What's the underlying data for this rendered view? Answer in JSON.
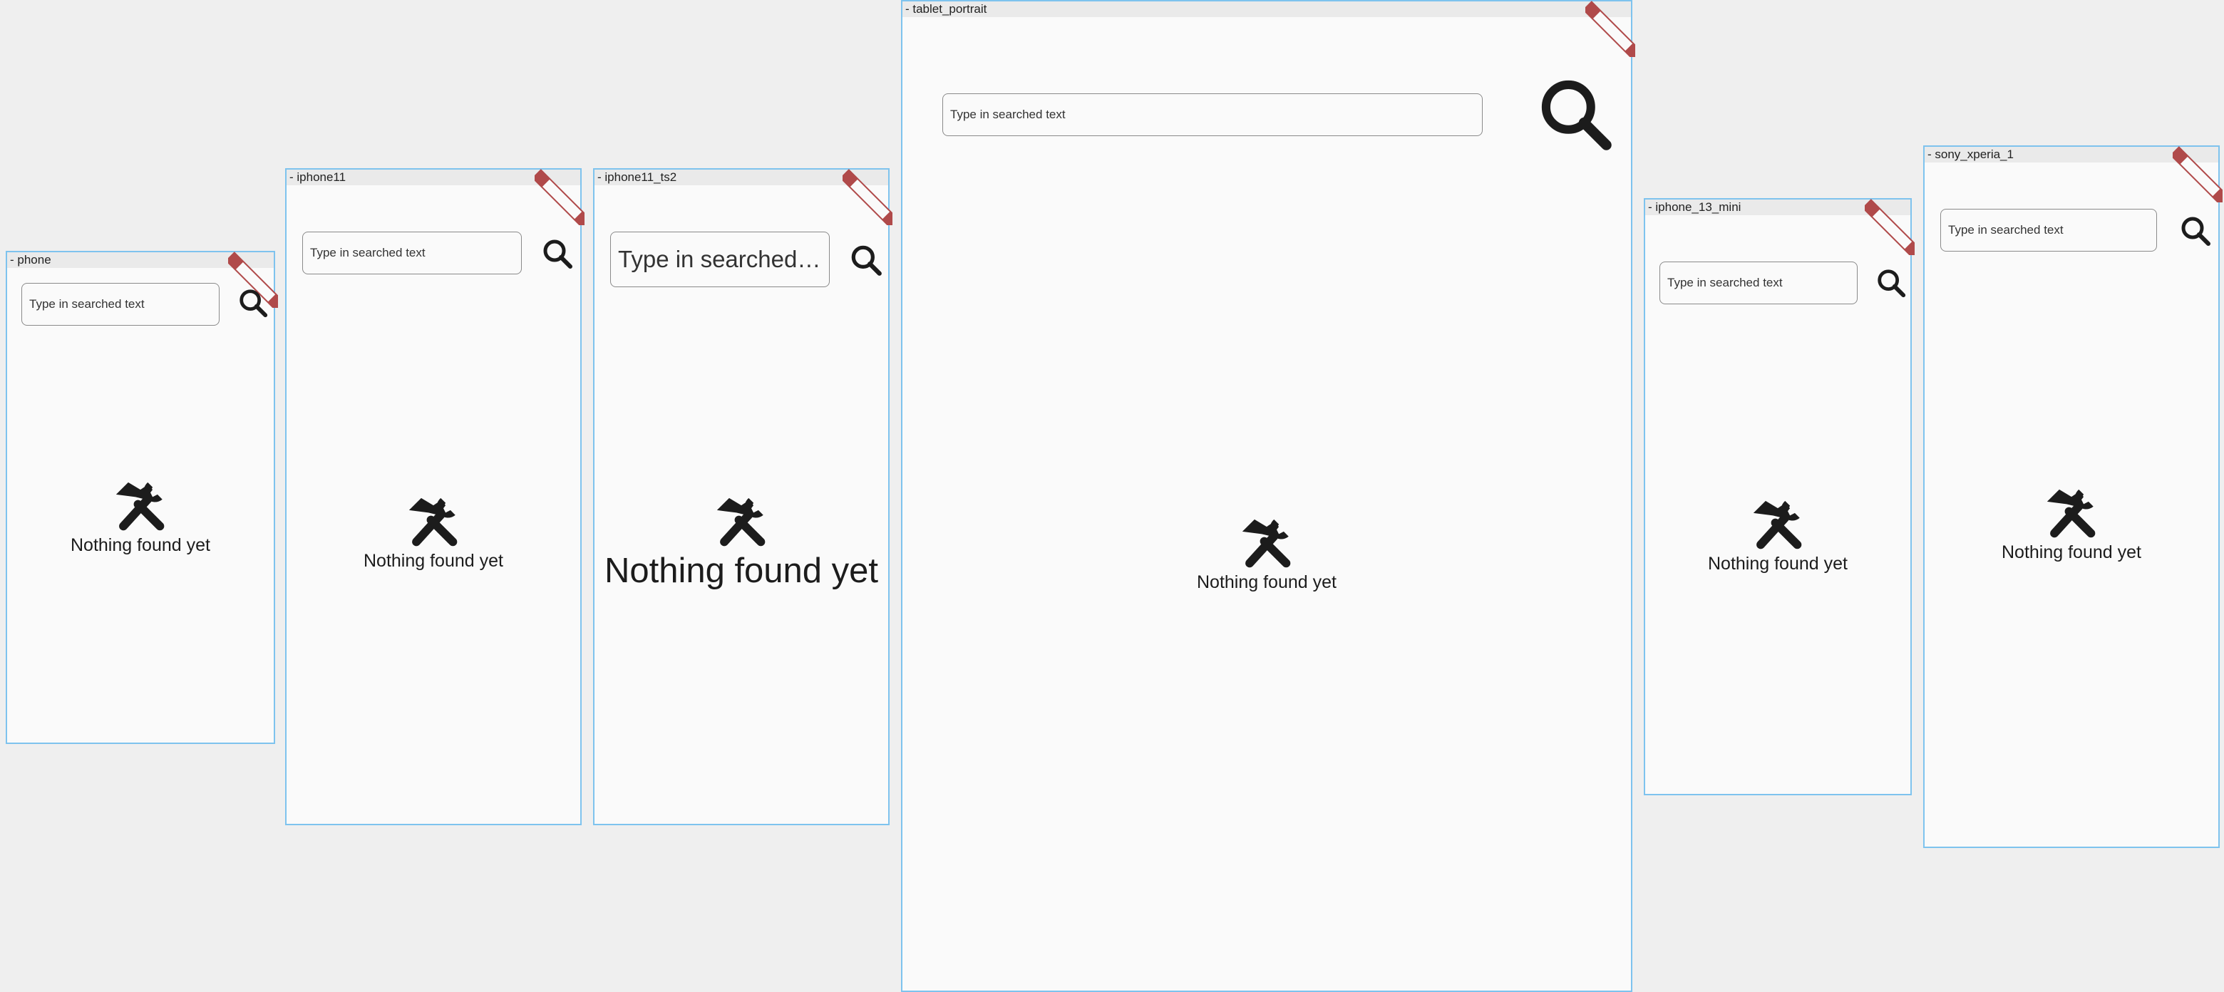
{
  "devices": {
    "phone": {
      "label": "- phone",
      "search_placeholder": "Type in searched text",
      "empty_text": "Nothing found yet"
    },
    "iphone11": {
      "label": "- iphone11",
      "search_placeholder": "Type in searched text",
      "empty_text": "Nothing found yet"
    },
    "iphone11_ts2": {
      "label": "- iphone11_ts2",
      "search_placeholder": "Type in searched text",
      "empty_text": "Nothing found yet"
    },
    "tablet_portrait": {
      "label": "- tablet_portrait",
      "search_placeholder": "Type in searched text",
      "empty_text": "Nothing found yet"
    },
    "iphone_13_mini": {
      "label": "- iphone_13_mini",
      "search_placeholder": "Type in searched text",
      "empty_text": "Nothing found yet"
    },
    "sony_xperia_1": {
      "label": "- sony_xperia_1",
      "search_placeholder": "Type in searched text",
      "empty_text": "Nothing found yet"
    }
  },
  "colors": {
    "canvas_background": "#efefef",
    "device_border": "#7ec3ee",
    "screen_background": "#fafafa",
    "debug_banner": "#b04a4a",
    "icon": "#1c1c1c"
  },
  "icons": {
    "search": "search-icon",
    "empty_state": "tools-icon",
    "debug": "debug-banner"
  }
}
